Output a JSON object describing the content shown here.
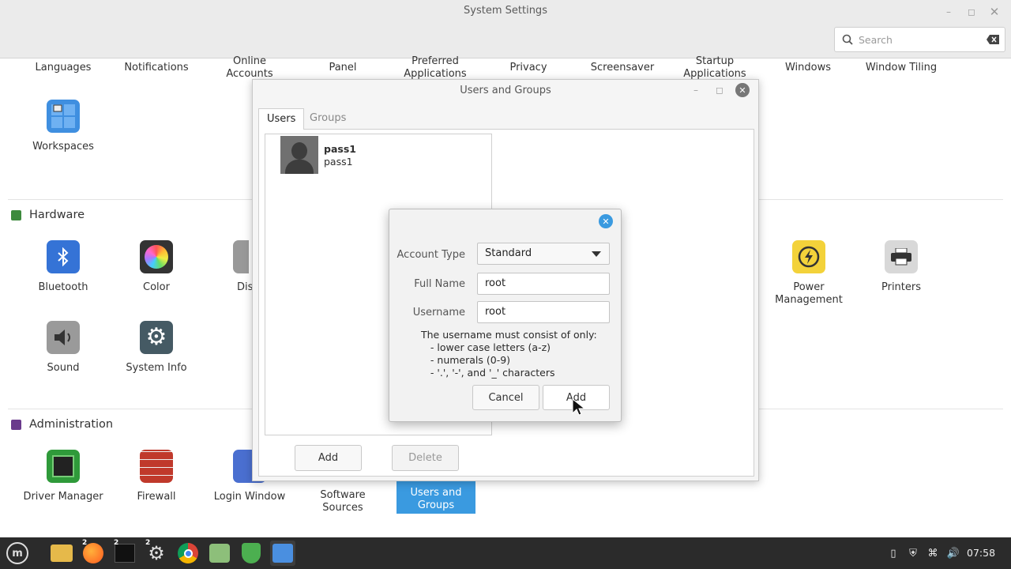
{
  "window": {
    "title": "System Settings",
    "search_placeholder": "Search"
  },
  "categories": [
    "Languages",
    "Notifications",
    "Online\nAccounts",
    "Panel",
    "Preferred\nApplications",
    "Privacy",
    "Screensaver",
    "Startup\nApplications",
    "Windows",
    "Window Tiling"
  ],
  "workspaces": {
    "label": "Workspaces"
  },
  "hardware": {
    "title": "Hardware",
    "items": {
      "bluetooth": "Bluetooth",
      "color": "Color",
      "display": "Dis",
      "power": "Power\nManagement",
      "printers": "Printers",
      "sound": "Sound",
      "sysinfo": "System Info"
    }
  },
  "administration": {
    "title": "Administration",
    "items": {
      "driver": "Driver Manager",
      "firewall": "Firewall",
      "login": "Login Window",
      "software": "Software\nSources",
      "users": "Users and\nGroups"
    }
  },
  "users_dialog": {
    "title": "Users and Groups",
    "tabs": [
      "Users",
      "Groups"
    ],
    "user": {
      "name": "pass1",
      "username": "pass1"
    },
    "add_label": "Add",
    "delete_label": "Delete"
  },
  "new_user_dialog": {
    "account_type_label": "Account Type",
    "account_type_value": "Standard",
    "full_name_label": "Full Name",
    "full_name_value": "root",
    "username_label": "Username",
    "username_value": "root",
    "hint": [
      "The username must consist of only:",
      "   - lower case letters (a-z)",
      "   - numerals (0-9)",
      "   - '.', '-', and '_' characters"
    ],
    "cancel_label": "Cancel",
    "add_label": "Add"
  },
  "taskbar": {
    "badges": [
      "2",
      "2",
      "2"
    ],
    "clock": "07:58"
  },
  "colors": {
    "accent": "#3a9ae0",
    "selected": "#3a9ae0",
    "taskbar": "#2b2b2b",
    "close": "#3a9ae0"
  }
}
